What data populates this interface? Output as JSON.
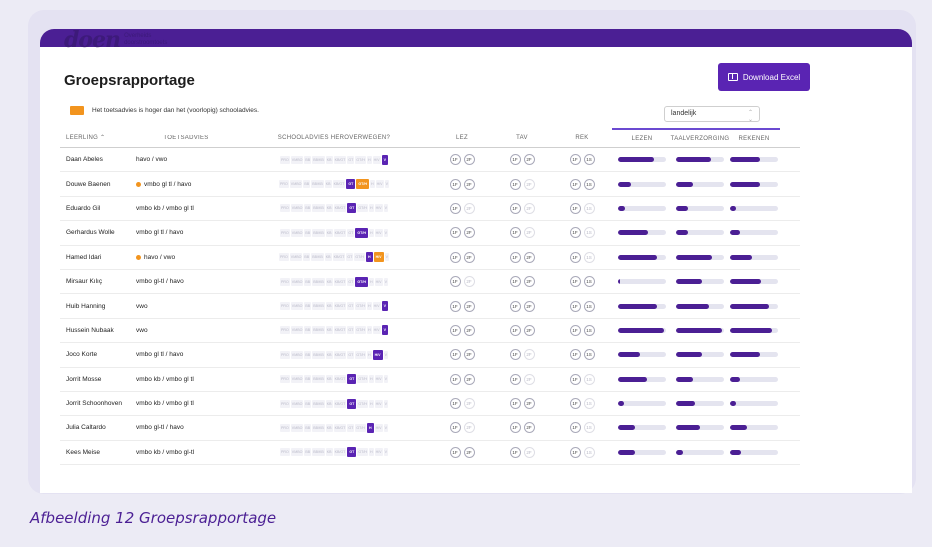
{
  "app": {
    "logo_word": "doen",
    "logo_sub_line1": "Overheids",
    "logo_sub_line2": "doorstroomtoets",
    "page_title": "Groepsrapportage",
    "download_label": "Download Excel",
    "legend_text": "Het toetsadvies is hoger dan het (voorlopig) schooladvies.",
    "scope_select_value": "landelijk"
  },
  "table": {
    "headers": {
      "leerling": "LEERLING ⌃",
      "toetsadvies": "TOETSADVIES",
      "herz": "SCHOOLADVIES HEROVERWEGEN?",
      "lez": "LEZ",
      "tav": "TAV",
      "rek": "REK",
      "lezen": "LEZEN",
      "taal": "TAALVERZORGING",
      "rekenen": "REKENEN"
    },
    "rows": [
      {
        "name": "Daan Abeles",
        "toets": "havo / vwo",
        "flag": false,
        "sel": 10,
        "org": -1,
        "lez": [
          true,
          true
        ],
        "tav": [
          true,
          true
        ],
        "rek": [
          true,
          true
        ],
        "bars": [
          0.75,
          0.72,
          0.62
        ]
      },
      {
        "name": "Douwe Baenen",
        "toets": "vmbo gl tl / havo",
        "flag": true,
        "sel": 6,
        "org": 7,
        "lez": [
          true,
          true
        ],
        "tav": [
          true,
          false
        ],
        "rek": [
          true,
          true
        ],
        "bars": [
          0.28,
          0.35,
          0.62
        ]
      },
      {
        "name": "Eduardo Gil",
        "toets": "vmbo kb / vmbo gl tl",
        "flag": false,
        "sel": 6,
        "org": -1,
        "lez": [
          true,
          false
        ],
        "tav": [
          true,
          false
        ],
        "rek": [
          true,
          false
        ],
        "bars": [
          0.15,
          0.25,
          0.12
        ]
      },
      {
        "name": "Gerhardus Wolle",
        "toets": "vmbo gl tl / havo",
        "flag": false,
        "sel": 7,
        "org": -1,
        "lez": [
          true,
          true
        ],
        "tav": [
          true,
          false
        ],
        "rek": [
          true,
          false
        ],
        "bars": [
          0.62,
          0.25,
          0.2
        ]
      },
      {
        "name": "Hamed Idari",
        "toets": "havo / vwo",
        "flag": true,
        "sel": 8,
        "org": 9,
        "lez": [
          true,
          true
        ],
        "tav": [
          true,
          true
        ],
        "rek": [
          true,
          false
        ],
        "bars": [
          0.82,
          0.75,
          0.45
        ]
      },
      {
        "name": "Mirsaur Kılıç",
        "toets": "vmbo gl-tl / havo",
        "flag": false,
        "sel": 7,
        "org": -1,
        "lez": [
          true,
          false
        ],
        "tav": [
          true,
          true
        ],
        "rek": [
          true,
          true
        ],
        "bars": [
          0.05,
          0.55,
          0.65
        ]
      },
      {
        "name": "Huib Hanning",
        "toets": "vwo",
        "flag": false,
        "sel": 10,
        "org": -1,
        "lez": [
          true,
          true
        ],
        "tav": [
          true,
          true
        ],
        "rek": [
          true,
          true
        ],
        "bars": [
          0.82,
          0.68,
          0.82
        ]
      },
      {
        "name": "Hussein Nubaak",
        "toets": "vwo",
        "flag": false,
        "sel": 10,
        "org": -1,
        "lez": [
          true,
          true
        ],
        "tav": [
          true,
          true
        ],
        "rek": [
          true,
          true
        ],
        "bars": [
          0.95,
          0.95,
          0.88
        ]
      },
      {
        "name": "Joco Korte",
        "toets": "vmbo gl tl / havo",
        "flag": false,
        "sel": 9,
        "org": -1,
        "lez": [
          true,
          true
        ],
        "tav": [
          true,
          false
        ],
        "rek": [
          true,
          true
        ],
        "bars": [
          0.45,
          0.55,
          0.62
        ]
      },
      {
        "name": "Jorrit Mosse",
        "toets": "vmbo kb / vmbo gl tl",
        "flag": false,
        "sel": 6,
        "org": -1,
        "lez": [
          true,
          true
        ],
        "tav": [
          true,
          false
        ],
        "rek": [
          true,
          false
        ],
        "bars": [
          0.6,
          0.35,
          0.2
        ]
      },
      {
        "name": "Jorrit Schoonhoven",
        "toets": "vmbo kb / vmbo gl tl",
        "flag": false,
        "sel": 6,
        "org": -1,
        "lez": [
          true,
          false
        ],
        "tav": [
          true,
          true
        ],
        "rek": [
          true,
          false
        ],
        "bars": [
          0.12,
          0.4,
          0.12
        ]
      },
      {
        "name": "Julia Caltardo",
        "toets": "vmbo gl-tl / havo",
        "flag": false,
        "sel": 8,
        "org": -1,
        "lez": [
          true,
          false
        ],
        "tav": [
          true,
          true
        ],
        "rek": [
          true,
          false
        ],
        "bars": [
          0.35,
          0.5,
          0.35
        ]
      },
      {
        "name": "Kees Meise",
        "toets": "vmbo kb / vmbo gl-tl",
        "flag": false,
        "sel": 6,
        "org": -1,
        "lez": [
          true,
          true
        ],
        "tav": [
          true,
          false
        ],
        "rek": [
          true,
          false
        ],
        "bars": [
          0.35,
          0.15,
          0.22
        ]
      }
    ],
    "chips": [
      "PRO",
      "VMBO",
      "BB",
      "BB/KB",
      "KB",
      "KB/GT",
      "GT",
      "GT/H",
      "H",
      "H/V",
      "V"
    ]
  },
  "caption": "Afbeelding 12 Groepsrapportage",
  "colors": {
    "primary": "#4b1f94",
    "accent": "#f2941e"
  }
}
